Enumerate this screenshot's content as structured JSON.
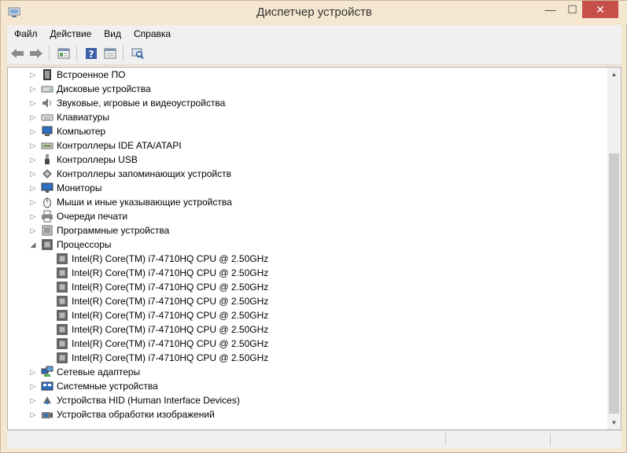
{
  "window": {
    "title": "Диспетчер устройств"
  },
  "menu": [
    "Файл",
    "Действие",
    "Вид",
    "Справка"
  ],
  "toolbar": [
    {
      "icon": "back-arrow-icon"
    },
    {
      "icon": "forward-arrow-icon"
    },
    {
      "icon": "properties-icon"
    },
    {
      "icon": "help-icon"
    },
    {
      "icon": "view-icon"
    },
    {
      "icon": "scan-hardware-icon"
    }
  ],
  "tree": [
    {
      "label": "Встроенное ПО",
      "icon": "firmware-icon",
      "state": "collapsed"
    },
    {
      "label": "Дисковые устройства",
      "icon": "disk-icon",
      "state": "collapsed"
    },
    {
      "label": "Звуковые, игровые и видеоустройства",
      "icon": "speaker-icon",
      "state": "collapsed"
    },
    {
      "label": "Клавиатуры",
      "icon": "keyboard-icon",
      "state": "collapsed"
    },
    {
      "label": "Компьютер",
      "icon": "computer-icon",
      "state": "collapsed"
    },
    {
      "label": "Контроллеры IDE ATA/ATAPI",
      "icon": "ide-controller-icon",
      "state": "collapsed"
    },
    {
      "label": "Контроллеры USB",
      "icon": "usb-icon",
      "state": "collapsed"
    },
    {
      "label": "Контроллеры запоминающих устройств",
      "icon": "storage-controller-icon",
      "state": "collapsed"
    },
    {
      "label": "Мониторы",
      "icon": "monitor-icon",
      "state": "collapsed"
    },
    {
      "label": "Мыши и иные указывающие устройства",
      "icon": "mouse-icon",
      "state": "collapsed"
    },
    {
      "label": "Очереди печати",
      "icon": "printer-icon",
      "state": "collapsed"
    },
    {
      "label": "Программные устройства",
      "icon": "software-device-icon",
      "state": "collapsed"
    },
    {
      "label": "Процессоры",
      "icon": "processor-icon",
      "state": "expanded",
      "children": [
        "Intel(R) Core(TM) i7-4710HQ CPU @ 2.50GHz",
        "Intel(R) Core(TM) i7-4710HQ CPU @ 2.50GHz",
        "Intel(R) Core(TM) i7-4710HQ CPU @ 2.50GHz",
        "Intel(R) Core(TM) i7-4710HQ CPU @ 2.50GHz",
        "Intel(R) Core(TM) i7-4710HQ CPU @ 2.50GHz",
        "Intel(R) Core(TM) i7-4710HQ CPU @ 2.50GHz",
        "Intel(R) Core(TM) i7-4710HQ CPU @ 2.50GHz",
        "Intel(R) Core(TM) i7-4710HQ CPU @ 2.50GHz"
      ]
    },
    {
      "label": "Сетевые адаптеры",
      "icon": "network-adapter-icon",
      "state": "collapsed"
    },
    {
      "label": "Системные устройства",
      "icon": "system-device-icon",
      "state": "collapsed"
    },
    {
      "label": "Устройства HID (Human Interface Devices)",
      "icon": "hid-icon",
      "state": "collapsed"
    },
    {
      "label": "Устройства обработки изображений",
      "icon": "camera-icon",
      "state": "collapsed"
    }
  ]
}
